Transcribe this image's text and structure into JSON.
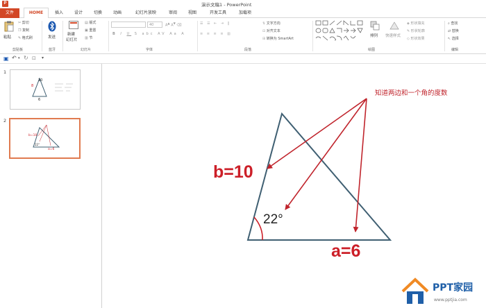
{
  "window": {
    "title": "演示文稿1 - PowerPoint",
    "app_icon": "powerpoint-icon"
  },
  "tabs": [
    {
      "label": "文件",
      "kind": "file"
    },
    {
      "label": "HOME",
      "kind": "active"
    },
    {
      "label": "插入"
    },
    {
      "label": "设计"
    },
    {
      "label": "切换"
    },
    {
      "label": "动画"
    },
    {
      "label": "幻灯片放映"
    },
    {
      "label": "审阅"
    },
    {
      "label": "视图"
    },
    {
      "label": "开发工具"
    },
    {
      "label": "加载项"
    }
  ],
  "ribbon": {
    "clipboard": {
      "paste": "粘贴",
      "cut": "剪切",
      "copy": "复制",
      "format_painter": "格式刷",
      "label": "剪贴板"
    },
    "bluetooth": {
      "send": "发送",
      "label": "蓝牙"
    },
    "slides": {
      "new_slide": "新建",
      "new_slide_2": "幻灯片",
      "layout": "版式",
      "reset": "重置",
      "section": "节",
      "label": "幻灯片"
    },
    "font": {
      "size": "40",
      "label": "字体"
    },
    "paragraph": {
      "text_direction": "文字方向",
      "align_text": "对齐文本",
      "smartart": "转换为 SmartArt",
      "label": "段落"
    },
    "drawing": {
      "arrange": "排列",
      "quick_styles": "快速样式",
      "shape_fill": "形状填充",
      "shape_outline": "形状轮廓",
      "shape_effects": "形状效果",
      "label": "绘图"
    },
    "editing": {
      "find": "查找",
      "replace": "替换",
      "select": "选择",
      "label": "编辑"
    }
  },
  "thumbnails": [
    {
      "number": "1",
      "label_b": "8",
      "label_top": "10",
      "label_bottom": "6"
    },
    {
      "number": "2",
      "label_b": "b=10",
      "label_angle": "22°",
      "label_a": "a=6"
    }
  ],
  "slide": {
    "annotation": "知道两边和一个角的度数",
    "label_b": "b=10",
    "label_angle": "22°",
    "label_a": "a=6"
  },
  "watermark": {
    "brand": "PPT家园",
    "url": "www.pptjia.com"
  },
  "colors": {
    "accent": "#d24726",
    "red_text": "#cc1f28",
    "triangle": "#3f5f72",
    "arrow": "#c0242c",
    "thumb_sel": "#e07a4f",
    "watermark_orange": "#f08a24",
    "watermark_blue": "#1f5fa8"
  }
}
